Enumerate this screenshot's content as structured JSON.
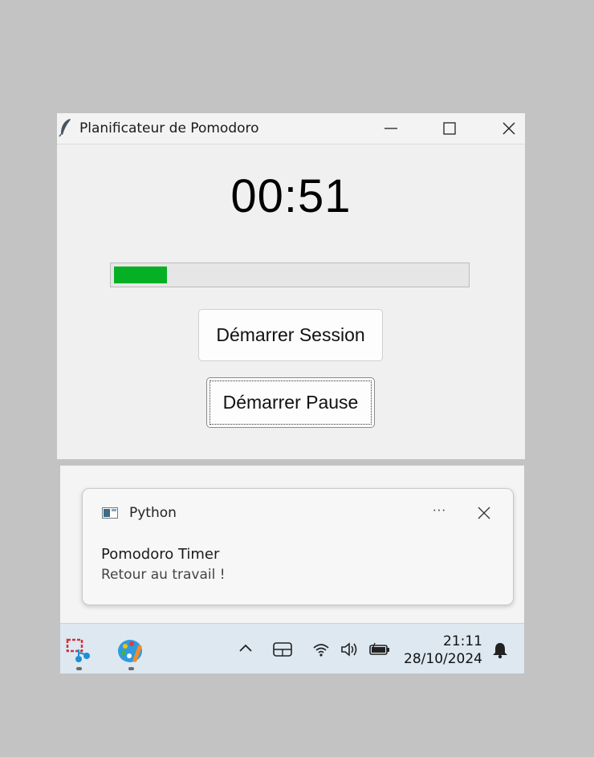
{
  "window": {
    "title": "Planificateur de Pomodoro",
    "icon": "feather-icon"
  },
  "timer": {
    "display": "00:51"
  },
  "progress": {
    "fraction": 0.15,
    "color": "#06b025"
  },
  "buttons": {
    "start_session": "Démarrer Session",
    "start_pause": "Démarrer Pause"
  },
  "notification": {
    "app_name": "Python",
    "more_label": "···",
    "title": "Pomodoro Timer",
    "message": "Retour au travail !"
  },
  "taskbar": {
    "apps": [
      "snipping-tool-icon",
      "paint-icon"
    ],
    "tray": [
      "chevron-up-icon",
      "touch-keyboard-icon",
      "wifi-icon",
      "volume-icon",
      "battery-icon"
    ],
    "time": "21:11",
    "date": "28/10/2024"
  }
}
